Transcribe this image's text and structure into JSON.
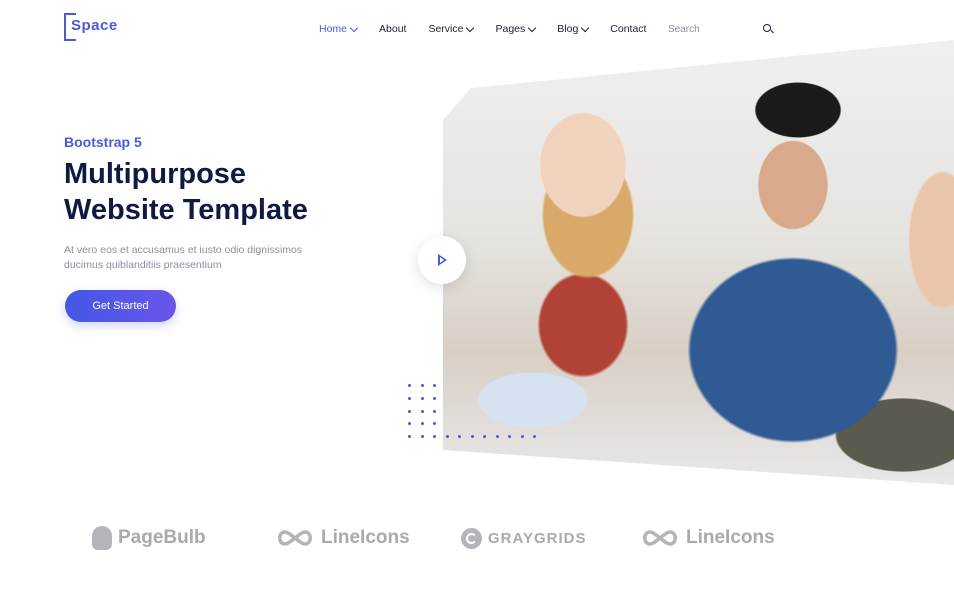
{
  "brand": {
    "logo_text": "Space"
  },
  "nav": {
    "items": [
      {
        "label": "Home",
        "has_dropdown": true,
        "active": true
      },
      {
        "label": "About",
        "has_dropdown": false,
        "active": false
      },
      {
        "label": "Service",
        "has_dropdown": true,
        "active": false
      },
      {
        "label": "Pages",
        "has_dropdown": true,
        "active": false
      },
      {
        "label": "Blog",
        "has_dropdown": true,
        "active": false
      },
      {
        "label": "Contact",
        "has_dropdown": false,
        "active": false
      }
    ]
  },
  "search": {
    "placeholder": "Search",
    "icon": "search-icon"
  },
  "hero": {
    "eyebrow": "Bootstrap 5",
    "headline_line1": "Multipurpose",
    "headline_line2": "Website Template",
    "description": "At vero eos et accusamus et iusto odio dignissimos ducimus quiblanditiis praesentium",
    "cta_label": "Get Started",
    "play_icon": "play-icon"
  },
  "brands": [
    {
      "name": "PageBulb",
      "icon": "bulb-icon"
    },
    {
      "name": "LineIcons",
      "icon": "infinity-icon"
    },
    {
      "name": "GRAYGRIDS",
      "icon": "graygrids-icon"
    },
    {
      "name": "LineIcons",
      "icon": "infinity-icon"
    }
  ],
  "colors": {
    "accent": "#4a5bd8",
    "heading": "#0f1a43",
    "muted": "#8a8f9c",
    "brand_gray": "#a8aab0"
  }
}
